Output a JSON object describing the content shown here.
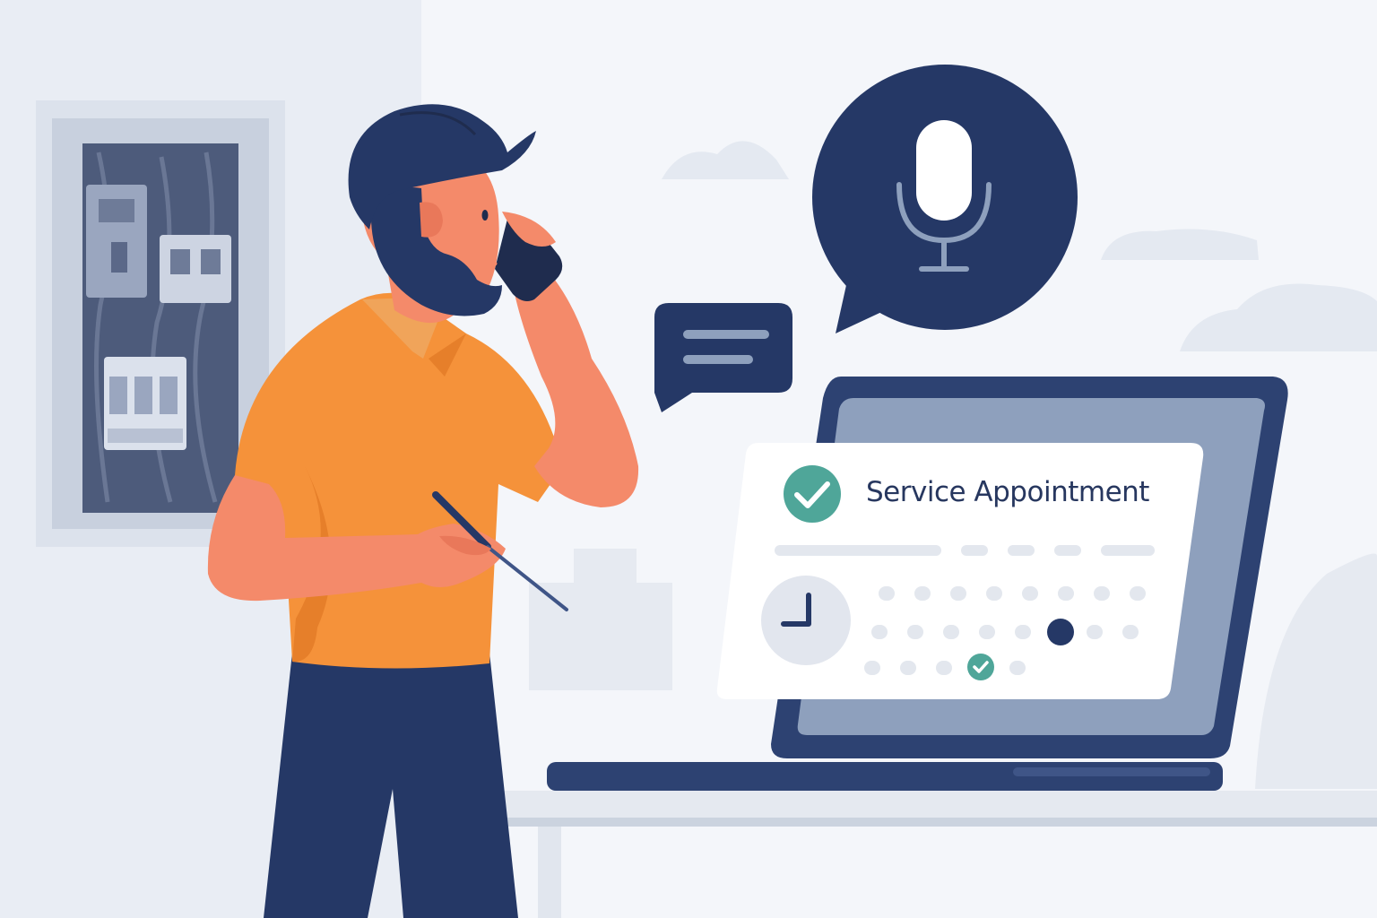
{
  "card": {
    "title": "Service Appointment"
  },
  "icons": {
    "status": "check-circle-icon",
    "voice": "microphone-icon",
    "message": "chat-bubble-icon",
    "time": "clock-icon",
    "selected_date": "check-icon"
  },
  "colors": {
    "navy": "#253866",
    "shirt": "#f5923a",
    "skin": "#f48a6a",
    "teal": "#4fa699",
    "background": "#f3f5f9"
  }
}
